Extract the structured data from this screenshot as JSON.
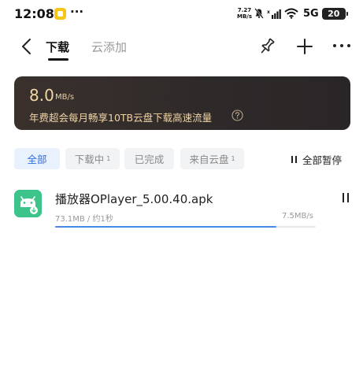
{
  "status_bar": {
    "time": "12:08",
    "more": "···",
    "net_speed_value": "7.27",
    "net_speed_unit": "MB/s",
    "network": "5G",
    "battery": "20"
  },
  "header": {
    "tab_download": "下载",
    "tab_cloud_add": "云添加",
    "icons": [
      "back-arrow-icon",
      "pin-icon",
      "plus-icon",
      "more-menu-icon"
    ]
  },
  "banner": {
    "speed_value": "8.0",
    "speed_unit": "MB/s",
    "promo_text": "年费超会每月畅享10TB云盘下载高速流量"
  },
  "filters": {
    "all": "全部",
    "downloading": "下载中",
    "downloading_count": "1",
    "completed": "已完成",
    "from_cloud": "来自云盘",
    "from_cloud_count": "1",
    "pause_all": "全部暂停"
  },
  "downloads": [
    {
      "file_name": "播放器OPlayer_5.00.40.apk",
      "size_info": "73.1MB / 约1秒",
      "rate": "7.5MB/s",
      "progress": 0.85
    }
  ],
  "colors": {
    "accent": "#2f6fe0",
    "progress": "#4a86e8",
    "banner_text": "#efd3a3",
    "app_icon": "#3cc48a"
  }
}
